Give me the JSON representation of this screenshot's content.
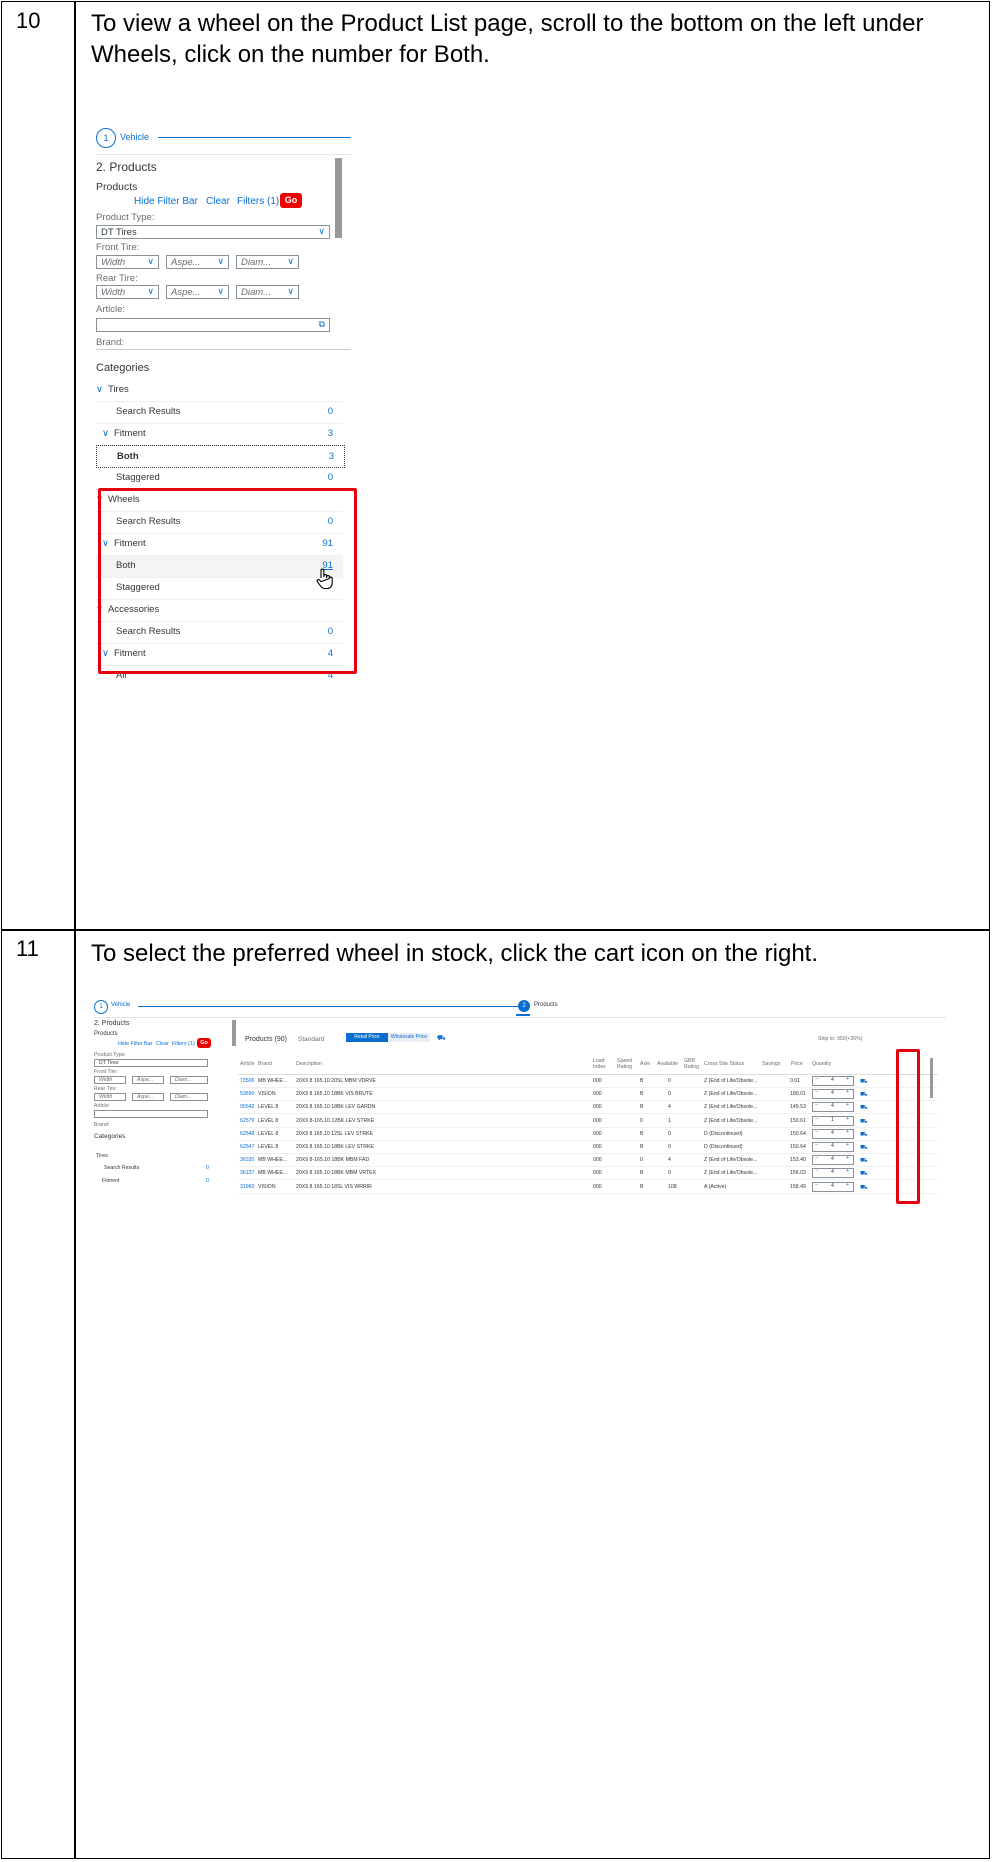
{
  "steps": [
    {
      "number": "10",
      "instruction": "To view a wheel on the Product List page, scroll to the bottom on the left under Wheels, click on the number for Both.",
      "screenshot": {
        "step_circle": "1",
        "step_label": "Vehicle",
        "section_title": "2. Products",
        "panel_title": "Products",
        "toolbar": {
          "hide_filter_bar": "Hide Filter Bar",
          "clear": "Clear",
          "filters": "Filters (1)",
          "go": "Go"
        },
        "product_type_label": "Product Type:",
        "product_type_value": "DT Tires",
        "front_tire_label": "Front Tire:",
        "rear_tire_label": "Rear Tire:",
        "tire_fields": [
          "Width",
          "Aspe...",
          "Diam..."
        ],
        "article_label": "Article:",
        "brand_label": "Brand:",
        "categories_title": "Categories",
        "categories": [
          {
            "label": "Tires",
            "count": ""
          },
          {
            "label": "Search Results",
            "count": "0"
          },
          {
            "label": "Fitment",
            "count": "3"
          },
          {
            "label": "Both",
            "count": "3"
          },
          {
            "label": "Staggered",
            "count": "0"
          },
          {
            "label": "Wheels",
            "count": ""
          },
          {
            "label": "Search Results",
            "count": "0"
          },
          {
            "label": "Fitment",
            "count": "91"
          },
          {
            "label": "Both",
            "count": "91"
          },
          {
            "label": "Staggered",
            "count": ""
          },
          {
            "label": "Accessories",
            "count": ""
          },
          {
            "label": "Search Results",
            "count": "0"
          },
          {
            "label": "Fitment",
            "count": "4"
          },
          {
            "label": "All",
            "count": "4"
          }
        ]
      }
    },
    {
      "number": "11",
      "instruction": "To select the preferred wheel in stock, click the cart icon on the right.",
      "screenshot": {
        "step1_circle": "1",
        "step1_label": "Vehicle",
        "step2_circle": "2",
        "step2_label": "Products",
        "section_title": "2. Products",
        "panel_title": "Products",
        "toolbar": {
          "hide_filter_bar": "Hide Filter Bar",
          "clear": "Clear",
          "filters": "Filters (1)",
          "go": "Go"
        },
        "product_type_label": "Product Type:",
        "product_type_value": "DT Tires",
        "front_tire_label": "Front Tire:",
        "rear_tire_label": "Rear Tire:",
        "article_label": "Article:",
        "brand_label": "Brand:",
        "categories_title": "Categories",
        "categories": [
          "Tires",
          "Search Results",
          "Fitment"
        ],
        "category_counts": [
          "",
          "0",
          "0"
        ],
        "tire_fields": [
          "Width",
          "Aspe...",
          "Diam..."
        ],
        "products_header": "Products (90)",
        "view_select": "Standard",
        "retail_price_btn": "Retail Price",
        "wholesale_price_btn": "Wholesale Price",
        "ship_to": "Ship to: 950(+30%)",
        "columns": [
          "Article",
          "Brand",
          "Description",
          "Load Index",
          "Speed Rating",
          "Axle",
          "Available",
          "GBB Rating",
          "Cross Site Status",
          "Savings",
          "Price",
          "Quantity"
        ],
        "rows": [
          {
            "article": "73506",
            "brand": "MB WHEE...",
            "desc": "20X9 8 165.10 20SL MBM VDRVE",
            "load": "000",
            "axle": "B",
            "avail": "0",
            "status": "Z (End of Life/Obsole...",
            "price": "0.01",
            "qty": "4"
          },
          {
            "article": "53690",
            "brand": "VISION",
            "desc": "20X9 8 165.10 18BK VIS BRUTE",
            "load": "000",
            "axle": "B",
            "avail": "0",
            "status": "Z (End of Life/Obsole...",
            "price": "180.01",
            "qty": "4"
          },
          {
            "article": "95542",
            "brand": "LEVEL 8",
            "desc": "20X9 8 165.10 18BK LEV GARDN",
            "load": "000",
            "axle": "B",
            "avail": "4",
            "status": "Z (End of Life/Obsole...",
            "price": "149.53",
            "qty": "4"
          },
          {
            "article": "62579",
            "brand": "LEVEL 8",
            "desc": "20X9 8-165.10 12BK LEV STRKE",
            "load": "000",
            "axle": "0",
            "avail": "1",
            "status": "Z (End of Life/Obsole...",
            "price": "150.61",
            "qty": "1"
          },
          {
            "article": "62548",
            "brand": "LEVEL 8",
            "desc": "20X9 8 165.10 12SL LEV STRKE",
            "load": "000",
            "axle": "B",
            "avail": "0",
            "status": "D (Discontinued)",
            "price": "150.64",
            "qty": "4"
          },
          {
            "article": "62547",
            "brand": "LEVEL 8",
            "desc": "20X9 8 165.10 18BK LEV STRKE",
            "load": "000",
            "axle": "B",
            "avail": "0",
            "status": "D (Discontinued)",
            "price": "150.64",
            "qty": "4"
          },
          {
            "article": "36330",
            "brand": "MB WHEE...",
            "desc": "20X9 8-165.10 18BK MBM FAD",
            "load": "000",
            "axle": "0",
            "avail": "4",
            "status": "Z (End of Life/Obsole...",
            "price": "153.40",
            "qty": "4"
          },
          {
            "article": "36137",
            "brand": "MB WHEE...",
            "desc": "20X9 8 165.10 18BK MBM VRTEX",
            "load": "000",
            "axle": "B",
            "avail": "0",
            "status": "Z (End of Life/Obsole...",
            "price": "156.03",
            "qty": "4"
          },
          {
            "article": "31960",
            "brand": "VISION",
            "desc": "20X9 8 165.10 18SL VIS WRRIR",
            "load": "000",
            "axle": "B",
            "avail": "108",
            "status": "A (Active)",
            "price": "158.49",
            "qty": "4"
          }
        ]
      }
    }
  ],
  "colors": {
    "accent": "#0a6ed1",
    "highlight": "#e5000d",
    "go": "#ee0000"
  }
}
